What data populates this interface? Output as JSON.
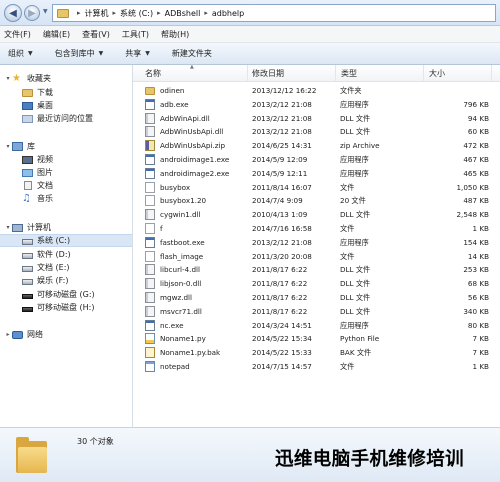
{
  "address": {
    "crumbs": [
      "计算机",
      "系统 (C:)",
      "ADBshell",
      "adbhelp"
    ]
  },
  "menu": [
    "文件(F)",
    "编辑(E)",
    "查看(V)",
    "工具(T)",
    "帮助(H)"
  ],
  "toolbar": {
    "organize": "组织",
    "include": "包含到库中",
    "share": "共享",
    "new_folder": "新建文件夹"
  },
  "nav": {
    "favorites": "收藏夹",
    "downloads": "下载",
    "desktop": "桌面",
    "recent": "最近访问的位置",
    "library": "库",
    "video": "视频",
    "pictures": "图片",
    "documents": "文档",
    "music": "音乐",
    "computer": "计算机",
    "drive_c": "系统 (C:)",
    "drive_d": "软件 (D:)",
    "drive_e": "文档 (E:)",
    "drive_f": "娱乐 (F:)",
    "drive_g": "可移动磁盘 (G:)",
    "drive_h": "可移动磁盘 (H:)",
    "network": "网络"
  },
  "columns": {
    "name": "名称",
    "date": "修改日期",
    "type": "类型",
    "size": "大小"
  },
  "files": [
    {
      "name": "odinen",
      "date": "2013/12/12 16:22",
      "type": "文件夹",
      "size": "",
      "icon": "folder"
    },
    {
      "name": "adb.exe",
      "date": "2013/2/12 21:08",
      "type": "应用程序",
      "size": "796 KB",
      "icon": "exe"
    },
    {
      "name": "AdbWinApi.dll",
      "date": "2013/2/12 21:08",
      "type": "DLL 文件",
      "size": "94 KB",
      "icon": "dll"
    },
    {
      "name": "AdbWinUsbApi.dll",
      "date": "2013/2/12 21:08",
      "type": "DLL 文件",
      "size": "60 KB",
      "icon": "dll"
    },
    {
      "name": "AdbWinUsbApi.zip",
      "date": "2014/6/25 14:31",
      "type": "zip Archive",
      "size": "472 KB",
      "icon": "zip"
    },
    {
      "name": "androidimage1.exe",
      "date": "2014/5/9 12:09",
      "type": "应用程序",
      "size": "467 KB",
      "icon": "exe"
    },
    {
      "name": "androidimage2.exe",
      "date": "2014/5/9 12:11",
      "type": "应用程序",
      "size": "465 KB",
      "icon": "exe"
    },
    {
      "name": "busybox",
      "date": "2011/8/14 16:07",
      "type": "文件",
      "size": "1,050 KB",
      "icon": "file"
    },
    {
      "name": "busybox1.20",
      "date": "2014/7/4 9:09",
      "type": "20 文件",
      "size": "487 KB",
      "icon": "file"
    },
    {
      "name": "cygwin1.dll",
      "date": "2010/4/13 1:09",
      "type": "DLL 文件",
      "size": "2,548 KB",
      "icon": "dll"
    },
    {
      "name": "f",
      "date": "2014/7/16 16:58",
      "type": "文件",
      "size": "1 KB",
      "icon": "file"
    },
    {
      "name": "fastboot.exe",
      "date": "2013/2/12 21:08",
      "type": "应用程序",
      "size": "154 KB",
      "icon": "exe"
    },
    {
      "name": "flash_image",
      "date": "2011/3/20 20:08",
      "type": "文件",
      "size": "14 KB",
      "icon": "file"
    },
    {
      "name": "libcurl-4.dll",
      "date": "2011/8/17 6:22",
      "type": "DLL 文件",
      "size": "253 KB",
      "icon": "dll"
    },
    {
      "name": "libjson-0.dll",
      "date": "2011/8/17 6:22",
      "type": "DLL 文件",
      "size": "68 KB",
      "icon": "dll"
    },
    {
      "name": "mgwz.dll",
      "date": "2011/8/17 6:22",
      "type": "DLL 文件",
      "size": "56 KB",
      "icon": "dll"
    },
    {
      "name": "msvcr71.dll",
      "date": "2011/8/17 6:22",
      "type": "DLL 文件",
      "size": "340 KB",
      "icon": "dll"
    },
    {
      "name": "nc.exe",
      "date": "2014/3/24 14:51",
      "type": "应用程序",
      "size": "80 KB",
      "icon": "exe"
    },
    {
      "name": "Noname1.py",
      "date": "2014/5/22 15:34",
      "type": "Python File",
      "size": "7 KB",
      "icon": "py"
    },
    {
      "name": "Noname1.py.bak",
      "date": "2014/5/22 15:33",
      "type": "BAK 文件",
      "size": "7 KB",
      "icon": "bak"
    },
    {
      "name": "notepad",
      "date": "2014/7/15 14:57",
      "type": "文件",
      "size": "1 KB",
      "icon": "np"
    }
  ],
  "status": {
    "count": "30 个对象"
  },
  "watermark": "迅维电脑手机维修培训"
}
